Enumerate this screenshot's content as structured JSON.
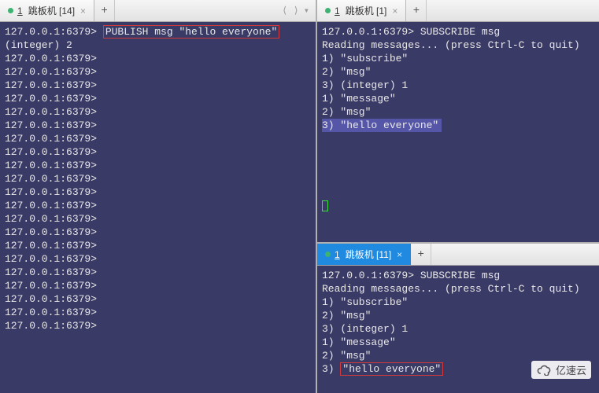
{
  "panes": {
    "left": {
      "tab": {
        "num": "1",
        "title": "跳板机 [14]"
      },
      "prompt": "127.0.0.1:6379>",
      "cmd": "PUBLISH msg \"hello everyone\"",
      "result": "(integer) 2",
      "blank_prompt_count": 21
    },
    "right_top": {
      "tab": {
        "num": "1",
        "title": "跳板机 [1]"
      },
      "prompt": "127.0.0.1:6379>",
      "cmd": "SUBSCRIBE msg",
      "reading": "Reading messages... (press Ctrl-C to quit)",
      "lines": [
        "1) \"subscribe\"",
        "2) \"msg\"",
        "3) (integer) 1",
        "1) \"message\"",
        "2) \"msg\""
      ],
      "boxed_line": "3) \"hello everyone\""
    },
    "right_bottom": {
      "tab": {
        "num": "1",
        "title": "跳板机 [11]"
      },
      "prompt": "127.0.0.1:6379>",
      "cmd": "SUBSCRIBE msg",
      "reading": "Reading messages... (press Ctrl-C to quit)",
      "lines": [
        "1) \"subscribe\"",
        "2) \"msg\"",
        "3) (integer) 1",
        "1) \"message\"",
        "2) \"msg\""
      ],
      "boxed_prefix": "3) ",
      "boxed_text": "\"hello everyone\""
    }
  },
  "icons": {
    "add": "+",
    "close": "×",
    "arrows": "⟨ ⟩",
    "menu": "▾"
  },
  "watermark": "亿速云"
}
